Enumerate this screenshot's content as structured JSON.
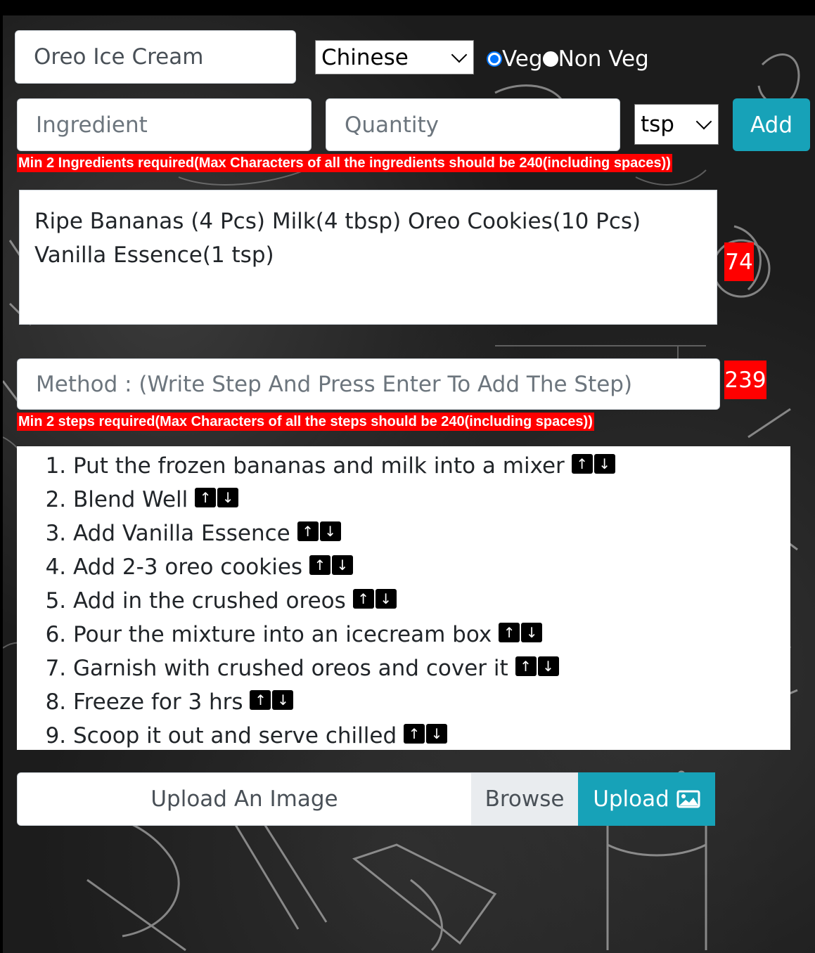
{
  "recipe": {
    "name_value": "Oreo Ice Cream",
    "cuisine_selected": "Chinese",
    "diet_options": [
      {
        "label": "Veg",
        "checked": true
      },
      {
        "label": "Non Veg",
        "checked": false
      }
    ]
  },
  "ingredient_form": {
    "ingredient_placeholder": "Ingredient",
    "quantity_placeholder": "Quantity",
    "unit_selected": "tsp",
    "add_label": "Add",
    "warning": "Min 2 Ingredients required(Max Characters of all the ingredients should be 240(including spaces))"
  },
  "ingredients": {
    "text": "Ripe Bananas (4 Pcs) Milk(4 tbsp) Oreo Cookies(10 Pcs) Vanilla Essence(1 tsp)",
    "counter": "74"
  },
  "method": {
    "placeholder": "Method : (Write Step And Press Enter To Add The Step)",
    "counter": "239",
    "warning": "Min 2 steps required(Max Characters of all the steps should be 240(including spaces))",
    "steps": [
      "Put the frozen bananas and milk into a mixer",
      "Blend Well",
      "Add Vanilla Essence",
      "Add 2-3 oreo cookies",
      "Add in the crushed oreos",
      "Pour the mixture into an icecream box",
      "Garnish with crushed oreos and cover it",
      "Freeze for 3 hrs",
      "Scoop it out and serve chilled"
    ],
    "up_glyph": "↑",
    "down_glyph": "↓"
  },
  "upload": {
    "field_label": "Upload An Image",
    "browse_label": "Browse",
    "upload_label": "Upload",
    "upload_icon": "image-icon"
  },
  "colors": {
    "accent": "#17a2b8",
    "warning": "#ff0000",
    "radio_checked": "#0075ff"
  }
}
